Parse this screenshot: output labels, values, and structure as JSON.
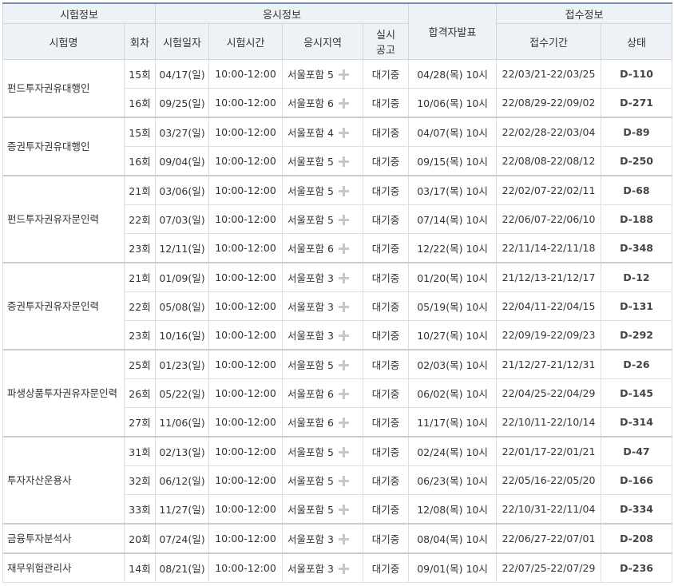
{
  "headers": {
    "group_exam": "시험정보",
    "group_apply": "응시정보",
    "announce": "합격자발표",
    "group_reg": "접수정보",
    "exam_name": "시험명",
    "round": "회차",
    "exam_date": "시험일자",
    "exam_time": "시험시간",
    "region": "응시지역",
    "notice_line1": "실시",
    "notice_line2": "공고",
    "reg_period": "접수기간",
    "status": "상태"
  },
  "exams": [
    {
      "name": "펀드투자권유대행인",
      "rows": [
        {
          "round": "15회",
          "date": "04/17(일)",
          "time": "10:00-12:00",
          "region": "서울포함 5",
          "notice": "대기중",
          "result": "04/28(목) 10시",
          "period": "22/03/21-22/03/25",
          "status": "D-110"
        },
        {
          "round": "16회",
          "date": "09/25(일)",
          "time": "10:00-12:00",
          "region": "서울포함 6",
          "notice": "대기중",
          "result": "10/06(목) 10시",
          "period": "22/08/29-22/09/02",
          "status": "D-271"
        }
      ]
    },
    {
      "name": "증권투자권유대행인",
      "rows": [
        {
          "round": "15회",
          "date": "03/27(일)",
          "time": "10:00-12:00",
          "region": "서울포함 4",
          "notice": "대기중",
          "result": "04/07(목) 10시",
          "period": "22/02/28-22/03/04",
          "status": "D-89"
        },
        {
          "round": "16회",
          "date": "09/04(일)",
          "time": "10:00-12:00",
          "region": "서울포함 5",
          "notice": "대기중",
          "result": "09/15(목) 10시",
          "period": "22/08/08-22/08/12",
          "status": "D-250"
        }
      ]
    },
    {
      "name": "펀드투자권유자문인력",
      "rows": [
        {
          "round": "21회",
          "date": "03/06(일)",
          "time": "10:00-12:00",
          "region": "서울포함 5",
          "notice": "대기중",
          "result": "03/17(목) 10시",
          "period": "22/02/07-22/02/11",
          "status": "D-68"
        },
        {
          "round": "22회",
          "date": "07/03(일)",
          "time": "10:00-12:00",
          "region": "서울포함 5",
          "notice": "대기중",
          "result": "07/14(목) 10시",
          "period": "22/06/07-22/06/10",
          "status": "D-188"
        },
        {
          "round": "23회",
          "date": "12/11(일)",
          "time": "10:00-12:00",
          "region": "서울포함 6",
          "notice": "대기중",
          "result": "12/22(목) 10시",
          "period": "22/11/14-22/11/18",
          "status": "D-348"
        }
      ]
    },
    {
      "name": "증권투자권유자문인력",
      "rows": [
        {
          "round": "21회",
          "date": "01/09(일)",
          "time": "10:00-12:00",
          "region": "서울포함 3",
          "notice": "대기중",
          "result": "01/20(목) 10시",
          "period": "21/12/13-21/12/17",
          "status": "D-12"
        },
        {
          "round": "22회",
          "date": "05/08(일)",
          "time": "10:00-12:00",
          "region": "서울포함 3",
          "notice": "대기중",
          "result": "05/19(목) 10시",
          "period": "22/04/11-22/04/15",
          "status": "D-131"
        },
        {
          "round": "23회",
          "date": "10/16(일)",
          "time": "10:00-12:00",
          "region": "서울포함 3",
          "notice": "대기중",
          "result": "10/27(목) 10시",
          "period": "22/09/19-22/09/23",
          "status": "D-292"
        }
      ]
    },
    {
      "name": "파생상품투자권유자문인력",
      "rows": [
        {
          "round": "25회",
          "date": "01/23(일)",
          "time": "10:00-12:00",
          "region": "서울포함 5",
          "notice": "대기중",
          "result": "02/03(목) 10시",
          "period": "21/12/27-21/12/31",
          "status": "D-26"
        },
        {
          "round": "26회",
          "date": "05/22(일)",
          "time": "10:00-12:00",
          "region": "서울포함 6",
          "notice": "대기중",
          "result": "06/02(목) 10시",
          "period": "22/04/25-22/04/29",
          "status": "D-145"
        },
        {
          "round": "27회",
          "date": "11/06(일)",
          "time": "10:00-12:00",
          "region": "서울포함 6",
          "notice": "대기중",
          "result": "11/17(목) 10시",
          "period": "22/10/11-22/10/14",
          "status": "D-314"
        }
      ]
    },
    {
      "name": "투자자산운용사",
      "rows": [
        {
          "round": "31회",
          "date": "02/13(일)",
          "time": "10:00-12:00",
          "region": "서울포함 5",
          "notice": "대기중",
          "result": "02/24(목) 10시",
          "period": "22/01/17-22/01/21",
          "status": "D-47"
        },
        {
          "round": "32회",
          "date": "06/12(일)",
          "time": "10:00-12:00",
          "region": "서울포함 5",
          "notice": "대기중",
          "result": "06/23(목) 10시",
          "period": "22/05/16-22/05/20",
          "status": "D-166"
        },
        {
          "round": "33회",
          "date": "11/27(일)",
          "time": "10:00-12:00",
          "region": "서울포함 5",
          "notice": "대기중",
          "result": "12/08(목) 10시",
          "period": "22/10/31-22/11/04",
          "status": "D-334"
        }
      ]
    },
    {
      "name": "금융투자분석사",
      "rows": [
        {
          "round": "20회",
          "date": "07/24(일)",
          "time": "10:00-12:00",
          "region": "서울포함 3",
          "notice": "대기중",
          "result": "08/04(목) 10시",
          "period": "22/06/27-22/07/01",
          "status": "D-208"
        }
      ]
    },
    {
      "name": "재무위험관리사",
      "rows": [
        {
          "round": "14회",
          "date": "08/21(일)",
          "time": "10:00-12:00",
          "region": "서울포함 3",
          "notice": "대기중",
          "result": "09/01(목) 10시",
          "period": "22/07/25-22/07/29",
          "status": "D-236"
        }
      ]
    }
  ]
}
